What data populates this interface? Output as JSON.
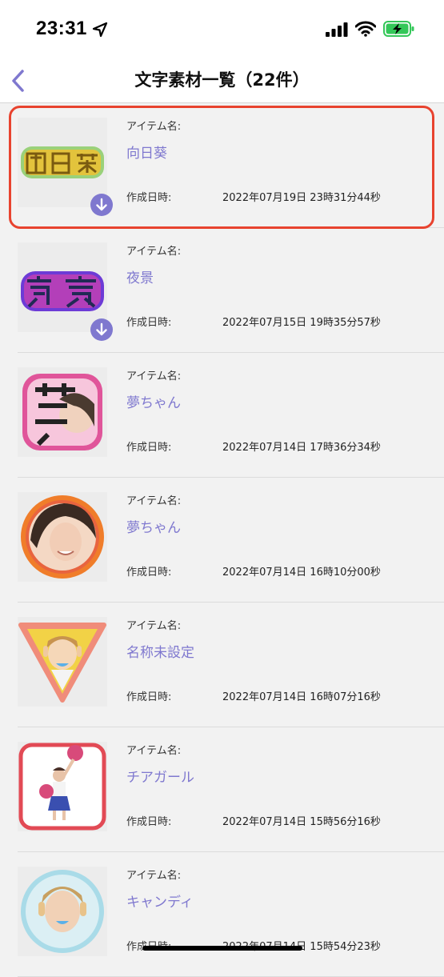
{
  "status_bar": {
    "time": "23:31",
    "icons": [
      "location-arrow-icon",
      "cellular-signal-icon",
      "wifi-icon",
      "battery-charging-icon"
    ]
  },
  "nav": {
    "title": "文字素材一覧（22件）",
    "back_icon": "chevron-left-icon"
  },
  "colors": {
    "accent": "#7f78cf",
    "highlight": "#e8432f",
    "background": "#f2f2f2"
  },
  "items": [
    {
      "label": "アイテム名:",
      "name": "向日葵",
      "created_label": "作成日時:",
      "created": "2022年07月19日 23時31分44秒",
      "thumbnail": "sunflower-text-sticker",
      "downloadable": true,
      "selected": true
    },
    {
      "label": "アイテム名:",
      "name": "夜景",
      "created_label": "作成日時:",
      "created": "2022年07月15日 19時35分57秒",
      "thumbnail": "night-view-text-sticker",
      "downloadable": true,
      "selected": false
    },
    {
      "label": "アイテム名:",
      "name": "夢ちゃん",
      "created_label": "作成日時:",
      "created": "2022年07月14日 17時36分34秒",
      "thumbnail": "pink-text-photo-sticker",
      "downloadable": false,
      "selected": false
    },
    {
      "label": "アイテム名:",
      "name": "夢ちゃん",
      "created_label": "作成日時:",
      "created": "2022年07月14日 16時10分00秒",
      "thumbnail": "circle-portrait-sticker",
      "downloadable": false,
      "selected": false
    },
    {
      "label": "アイテム名:",
      "name": "名称未設定",
      "created_label": "作成日時:",
      "created": "2022年07月14日 16時07分16秒",
      "thumbnail": "triangle-portrait-sticker",
      "downloadable": false,
      "selected": false
    },
    {
      "label": "アイテム名:",
      "name": "チアガール",
      "created_label": "作成日時:",
      "created": "2022年07月14日 15時56分16秒",
      "thumbnail": "cheerleader-sticker",
      "downloadable": false,
      "selected": false
    },
    {
      "label": "アイテム名:",
      "name": "キャンディ",
      "created_label": "作成日時:",
      "created": "2022年07月14日 15時54分23秒",
      "thumbnail": "candy-circle-sticker",
      "downloadable": false,
      "selected": false
    }
  ]
}
